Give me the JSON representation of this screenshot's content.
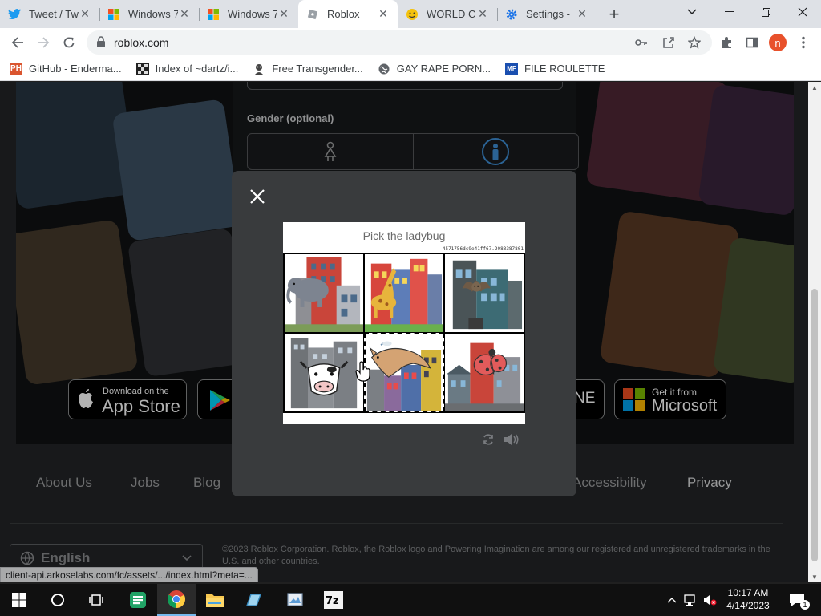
{
  "browser": {
    "tabs": [
      {
        "title": "Tweet / Tw",
        "icon": "twitter-icon",
        "active": false
      },
      {
        "title": "Windows 7",
        "icon": "windows-icon",
        "active": false
      },
      {
        "title": "Windows 7",
        "icon": "windows-icon",
        "active": false
      },
      {
        "title": "Roblox",
        "icon": "roblox-icon",
        "active": true
      },
      {
        "title": "WORLD C",
        "icon": "smiley-icon",
        "active": false
      },
      {
        "title": "Settings -",
        "icon": "gear-icon",
        "active": false
      }
    ],
    "url": "roblox.com",
    "profile_initial": "n",
    "bookmarks": [
      {
        "label": "GitHub - Enderma...",
        "icon": "ph-icon"
      },
      {
        "label": "Index of ~dartz/i...",
        "icon": "grid-icon"
      },
      {
        "label": "Free Transgender...",
        "icon": "character-icon"
      },
      {
        "label": "GAY RAPE PORN...",
        "icon": "globe-icon"
      },
      {
        "label": "FILE ROULETTE",
        "icon": "mf-icon"
      }
    ],
    "status_url": "client-api.arkoselabs.com/fc/assets/.../index.html?meta=..."
  },
  "signup": {
    "gender_label": "Gender (optional)"
  },
  "stores": {
    "apple_small": "Download on the",
    "apple_big": "App Store",
    "microsoft_small": "Get it from",
    "microsoft_big": "Microsoft",
    "partial_text": "NE"
  },
  "footer": {
    "links": [
      "About Us",
      "Jobs",
      "Blog",
      "Accessibility",
      "Privacy"
    ],
    "language": "English",
    "copyright": "©2023 Roblox Corporation. Roblox, the Roblox logo and Powering Imagination are among our registered and unregistered trademarks in the U.S. and other countries."
  },
  "captcha": {
    "prompt": "Pick the ladybug",
    "session_id": "4571756dc9e41ff67.2083387801",
    "cells": [
      {
        "animal": "elephant",
        "selected": false
      },
      {
        "animal": "giraffe",
        "selected": false
      },
      {
        "animal": "bat",
        "selected": false
      },
      {
        "animal": "cow",
        "selected": false
      },
      {
        "animal": "kangaroo",
        "selected": true
      },
      {
        "animal": "ladybug",
        "selected": false
      }
    ]
  },
  "taskbar": {
    "time": "10:17 AM",
    "date": "4/14/2023",
    "notification_count": "1",
    "apps": [
      "start-icon",
      "cortana-icon",
      "task-view-icon",
      "sheets-icon",
      "chrome-icon",
      "file-explorer-icon",
      "app-icon",
      "paint-icon",
      "7zip-icon"
    ]
  },
  "colors": {
    "page_bg": "#232527",
    "modal_bg": "#393b3d",
    "accent_blue": "#0078d7"
  }
}
